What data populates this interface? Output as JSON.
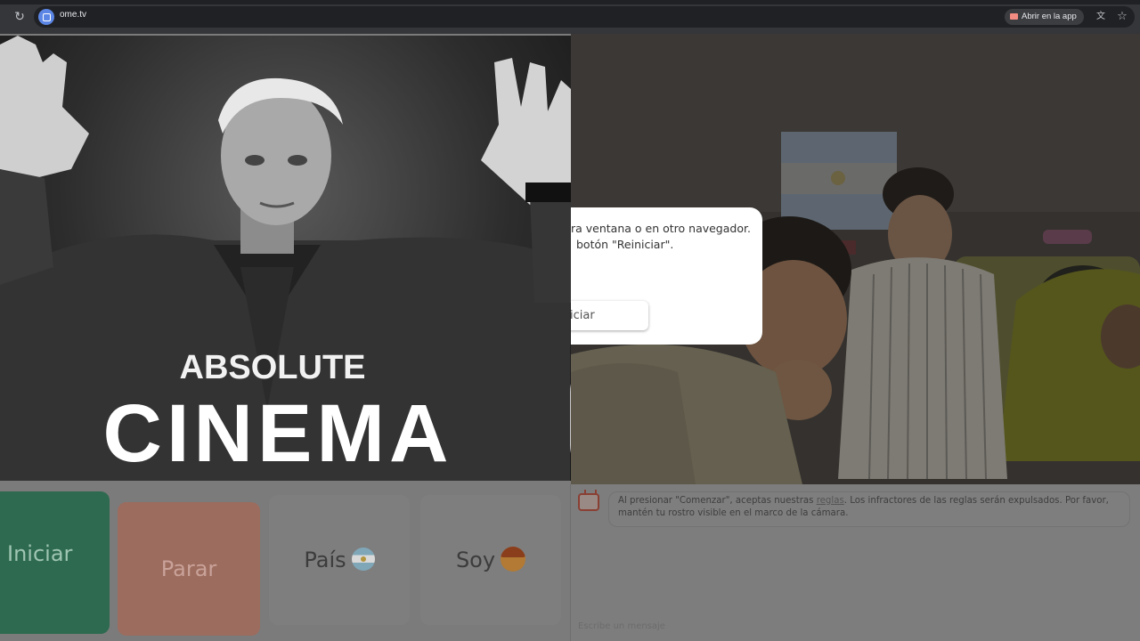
{
  "browser": {
    "url": "ome.tv",
    "open_in_app": "Abrir en la app",
    "icons": {
      "reload": "reload-icon",
      "translate": "translate-icon",
      "bookmark": "star-icon"
    }
  },
  "left_video": {
    "caption_top": "ABSOLUTE",
    "caption_bottom": "CINEMA"
  },
  "dialog": {
    "line1": "ra ventana o en otro navegador.",
    "line2": "botón \"Reiniciar\".",
    "button": "iciar"
  },
  "controls": {
    "start": "Iniciar",
    "stop": "Parar",
    "country": "País",
    "soy": "Soy",
    "colors": {
      "start": "#2e6a4f",
      "stop": "#9c6c5e",
      "neutral": "#7e7e7e"
    }
  },
  "chat": {
    "notice_prefix": "Al presionar \"Comenzar\", aceptas nuestras ",
    "notice_link": "reglas",
    "notice_suffix": ". Los infractores de las reglas serán expulsados. Por favor, mantén tu rostro visible en el marco de la cámara.",
    "input_placeholder": "Escribe un mensaje"
  }
}
